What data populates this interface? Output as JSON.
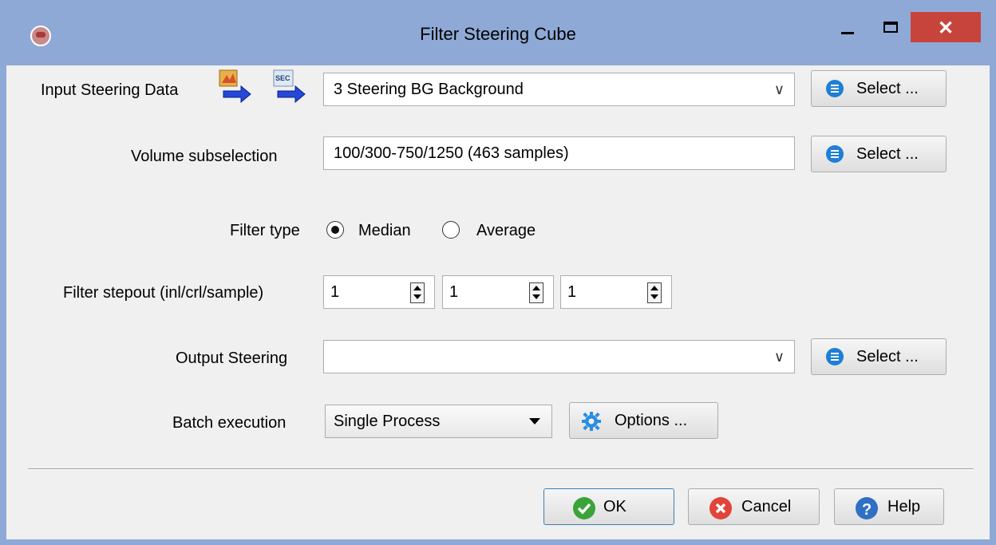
{
  "window": {
    "title": "Filter Steering Cube"
  },
  "input_steering": {
    "label": "Input Steering Data",
    "value": "3 Steering BG Background",
    "select_label": "Select ..."
  },
  "volume": {
    "label": "Volume subselection",
    "value": "100/300-750/1250 (463 samples)",
    "select_label": "Select ..."
  },
  "filter_type": {
    "label": "Filter type",
    "options": [
      "Median",
      "Average"
    ],
    "selected": "Median"
  },
  "stepout": {
    "label": "Filter stepout (inl/crl/sample)",
    "values": [
      "1",
      "1",
      "1"
    ]
  },
  "output_steering": {
    "label": "Output Steering",
    "value": "",
    "select_label": "Select ..."
  },
  "batch": {
    "label": "Batch execution",
    "value": "Single Process",
    "options_label": "Options ..."
  },
  "footer": {
    "ok_label": "OK",
    "cancel_label": "Cancel",
    "help_label": "Help"
  },
  "colors": {
    "titlebar": "#8fa9d6",
    "close": "#c7443c",
    "accent": "#1e7fd6",
    "ok": "#3aa33a",
    "cancel": "#e0443a"
  },
  "icons": [
    "app-icon",
    "minimize-icon",
    "maximize-icon",
    "close-icon",
    "import-2d-icon",
    "import-sec-icon",
    "list-icon",
    "gear-icon",
    "check-icon",
    "cancel-icon",
    "help-icon",
    "chevron-down-icon",
    "spinner-icon"
  ]
}
